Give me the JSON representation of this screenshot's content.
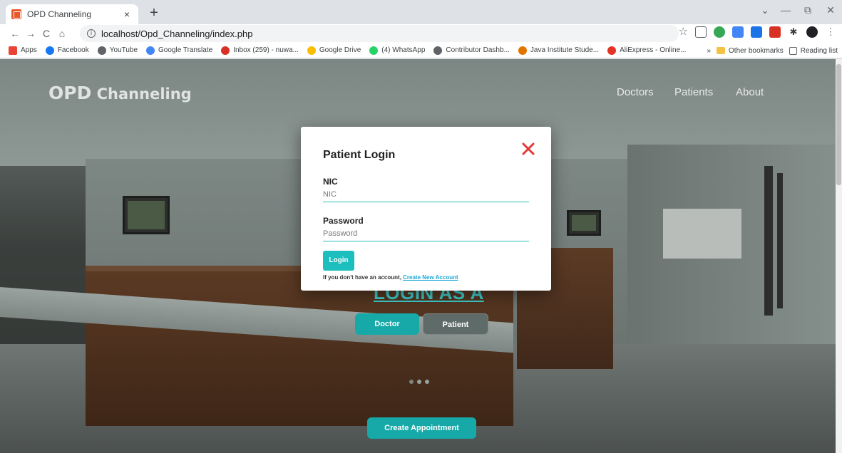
{
  "browser": {
    "tab_title": "OPD Channeling",
    "tab_close": "×",
    "new_tab": "+",
    "url": "localhost/Opd_Channeling/index.php",
    "nav": {
      "back": "←",
      "forward": "→",
      "reload": "C",
      "home": "⌂"
    },
    "window": {
      "minimize": "—",
      "restore": "⧉",
      "close": "✕",
      "tabsearch": "⌄"
    },
    "bookmarks": [
      {
        "label": "Apps",
        "color": "#ea4335"
      },
      {
        "label": "Facebook",
        "color": "#1877f2"
      },
      {
        "label": "YouTube",
        "color": "#5f6368"
      },
      {
        "label": "Google Translate",
        "color": "#4285f4"
      },
      {
        "label": "Inbox (259) - nuwa...",
        "color": "#d93025"
      },
      {
        "label": "Google Drive",
        "color": "#fbbc04"
      },
      {
        "label": "(4) WhatsApp",
        "color": "#25d366"
      },
      {
        "label": "Contributor Dashb...",
        "color": "#5f6368"
      },
      {
        "label": "Java Institute Stude...",
        "color": "#e37400"
      },
      {
        "label": "AliExpress - Online...",
        "color": "#e43225"
      }
    ],
    "bookmarks_more": "»",
    "other_bookmarks": "Other bookmarks",
    "reading_list": "Reading list",
    "star": "☆",
    "extension_colors": [
      "#5f6368",
      "#34a853",
      "#4285f4",
      "#1a73e8",
      "#d93025",
      "#3c4043",
      "#202124"
    ]
  },
  "page": {
    "brand_main": "OPD",
    "brand_sub": "Channeling",
    "nav": [
      "Doctors",
      "Patients",
      "About"
    ],
    "login_as": "LOGIN AS A",
    "role_buttons": [
      "Doctor",
      "Patient"
    ],
    "create_appointment": "Create Appointment",
    "accent": "#16a9a8"
  },
  "modal": {
    "title": "Patient Login",
    "nic_label": "NIC",
    "nic_placeholder": "NIC",
    "password_label": "Password",
    "password_placeholder": "Password",
    "login_button": "Login",
    "signup_prompt": "If you don't have an account, ",
    "signup_link": "Create New Account",
    "close_color": "#e53935"
  }
}
